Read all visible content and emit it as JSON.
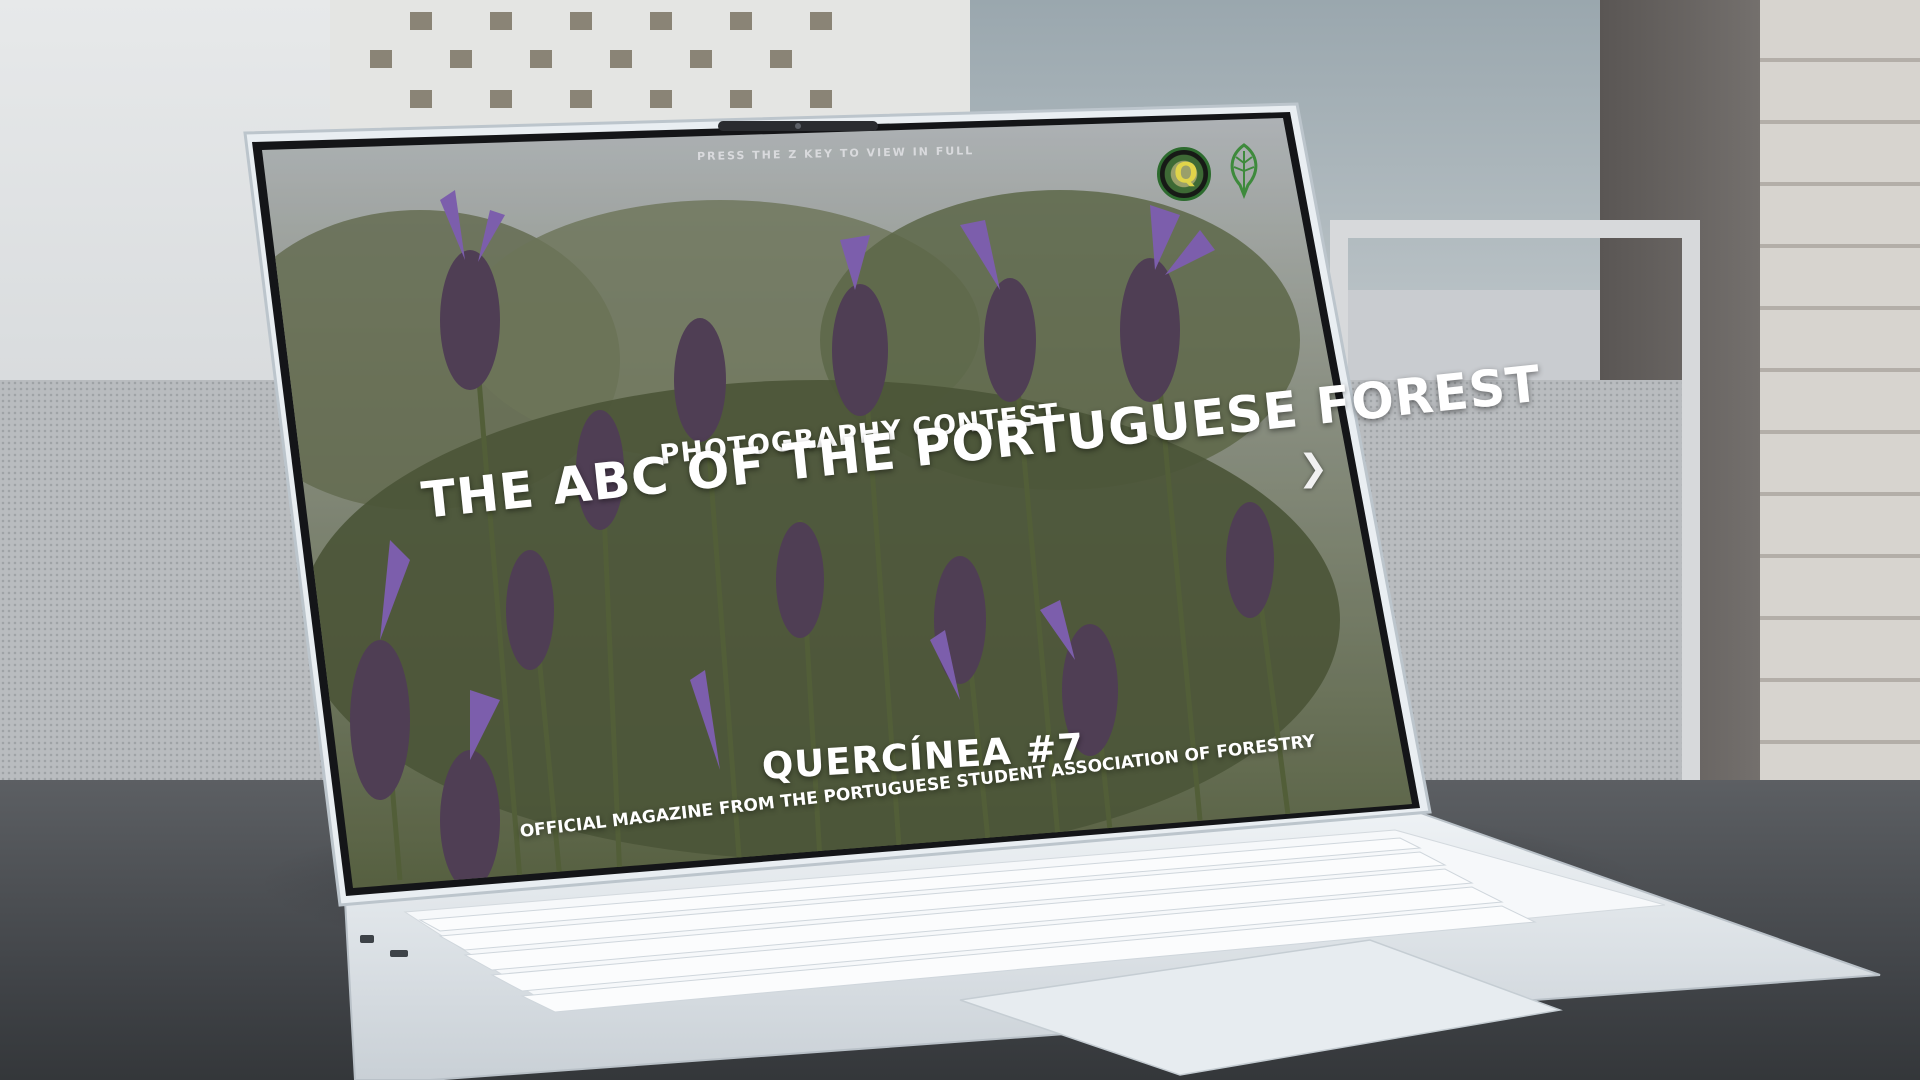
{
  "screen": {
    "hint": "PRESS THE Z KEY TO VIEW IN FULL",
    "contest_label": "PHOTOGRAPHY CONTEST",
    "contest_title": "THE ABC OF THE PORTUGUESE FOREST",
    "magazine_title": "QUERCÍNEA #7",
    "magazine_subtitle": "OFFICIAL MAGAZINE FROM THE PORTUGUESE STUDENT ASSOCIATION OF FORESTRY",
    "logo_a_letter": "Q",
    "next_icon": "chevron-right-icon"
  },
  "colors": {
    "lavender": "#8e6bc4",
    "foliage": "#6e7a55",
    "laptop_silver": "#dfe5ea"
  }
}
